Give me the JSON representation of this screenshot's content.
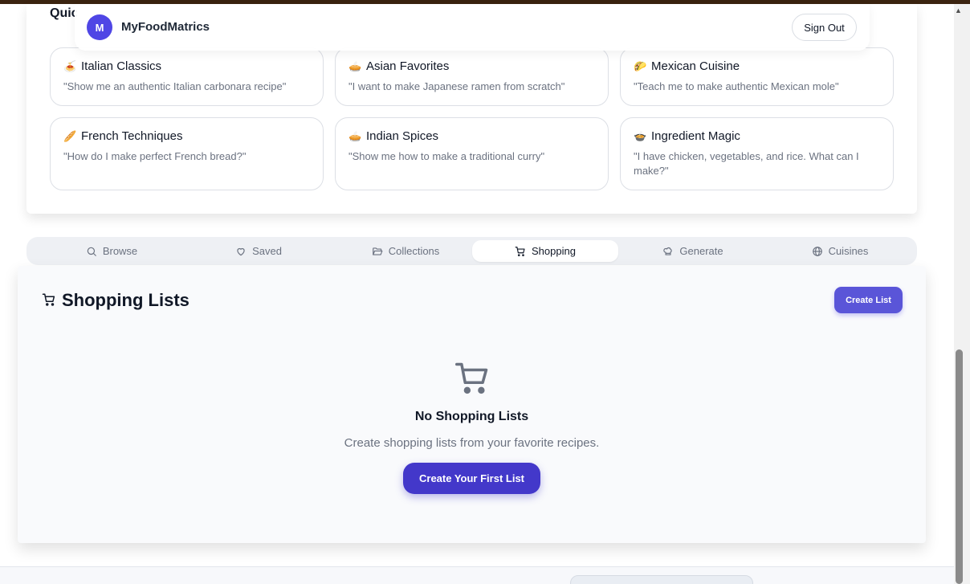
{
  "app": {
    "brand": "MyFoodMatrics",
    "avatar_initial": "M",
    "sign_out_label": "Sign Out"
  },
  "quick_start": {
    "title": "Quic",
    "prompts": [
      {
        "emoji": "🍝",
        "title": "Italian Classics",
        "text": "\"Show me an authentic Italian carbonara recipe\""
      },
      {
        "emoji": "🥧",
        "title": "Asian Favorites",
        "text": "\"I want to make Japanese ramen from scratch\""
      },
      {
        "emoji": "🌮",
        "title": "Mexican Cuisine",
        "text": "\"Teach me to make authentic Mexican mole\""
      },
      {
        "emoji": "🥖",
        "title": "French Techniques",
        "text": "\"How do I make perfect French bread?\""
      },
      {
        "emoji": "🥧",
        "title": "Indian Spices",
        "text": "\"Show me how to make a traditional curry\""
      },
      {
        "emoji": "🍲",
        "title": "Ingredient Magic",
        "text": "\"I have chicken, vegetables, and rice. What can I make?\""
      }
    ]
  },
  "tabs": [
    {
      "label": "Browse",
      "icon": "search-icon",
      "active": false
    },
    {
      "label": "Saved",
      "icon": "heart-icon",
      "active": false
    },
    {
      "label": "Collections",
      "icon": "folder-open-icon",
      "active": false
    },
    {
      "label": "Shopping",
      "icon": "cart-icon",
      "active": true
    },
    {
      "label": "Generate",
      "icon": "chef-hat-icon",
      "active": false
    },
    {
      "label": "Cuisines",
      "icon": "globe-icon",
      "active": false
    }
  ],
  "shopping": {
    "title": "Shopping Lists",
    "create_list_label": "Create List",
    "empty_title": "No Shopping Lists",
    "empty_desc": "Create shopping lists from your favorite recipes.",
    "create_first_label": "Create Your First List"
  },
  "colors": {
    "accent": "#4f46e5",
    "button": "#4338ca"
  }
}
